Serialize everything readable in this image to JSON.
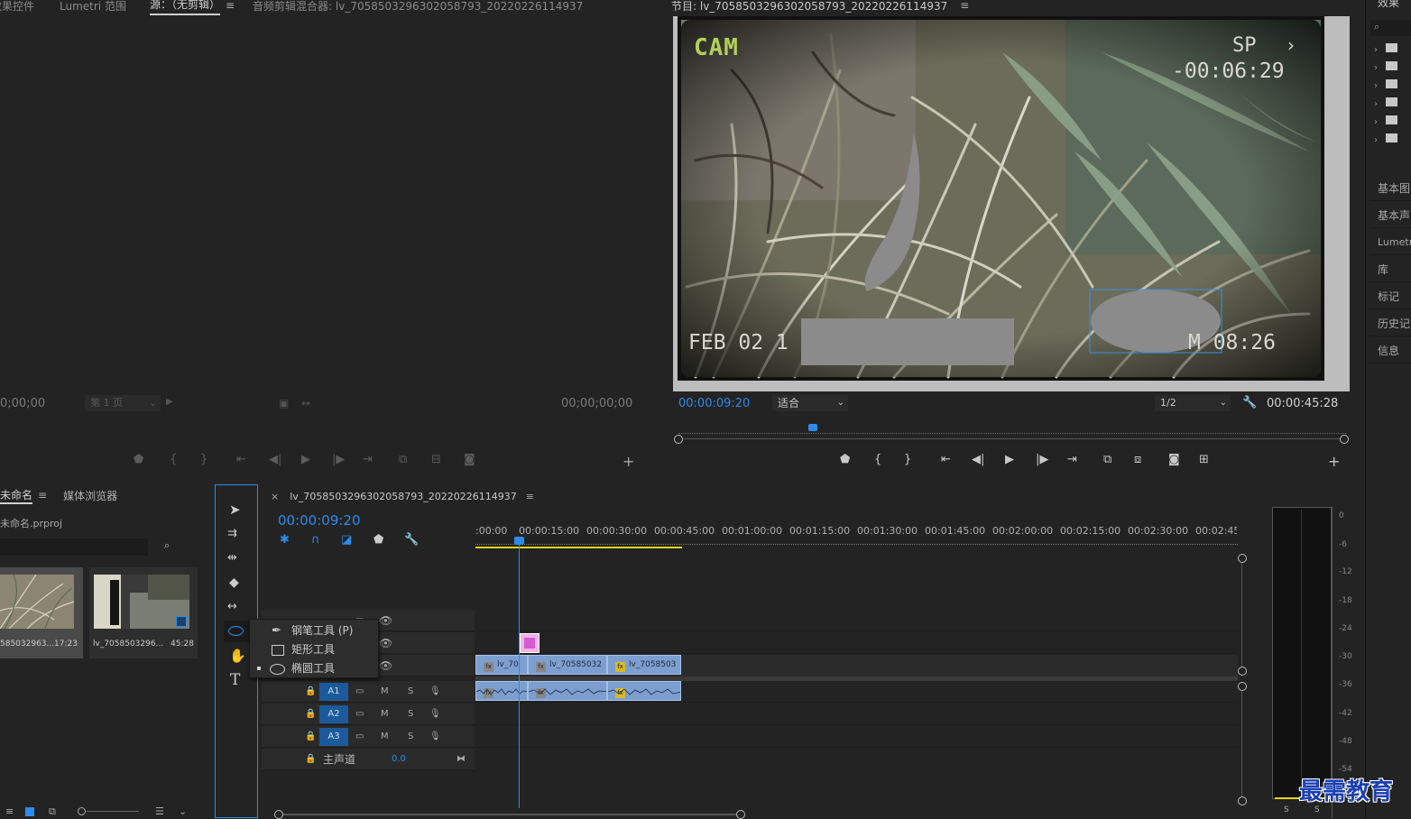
{
  "source_panel": {
    "tabs": [
      "效果控件",
      "Lumetri 范围",
      "源：（无剪辑）",
      "音频剪辑混合器: lv_7058503296302058793_20220226114937"
    ],
    "timecode_left": "0;00;00",
    "page_select": "第 1 页",
    "timecode_right": "00;00;00;00"
  },
  "program_panel": {
    "title": "节目: lv_7058503296302058793_20220226114937",
    "timecode": "00:00:09:20",
    "fit": "适合",
    "resolution": "1/2",
    "duration": "00:00:45:28",
    "overlay": {
      "cam": "CAM",
      "sp": "SP",
      "counter": "-00:06:29",
      "date": "FEB 02 1",
      "time": "M 08:26"
    }
  },
  "right_panel": {
    "title": "效果",
    "items": [
      "基本图",
      "基本声",
      "Lumetri",
      "库",
      "标记",
      "历史记",
      "信息"
    ]
  },
  "project_panel": {
    "tabs": [
      "未命名",
      "媒体浏览器"
    ],
    "project_file": "未命名.prproj",
    "clips": [
      {
        "name": "585032963...",
        "duration": "17:23"
      },
      {
        "name": "lv_7058503296...",
        "duration": "45:28"
      }
    ]
  },
  "timeline": {
    "sequence_tab": "lv_7058503296302058793_20220226114937",
    "timecode": "00:00:09:20",
    "ruler": [
      ":00:00",
      "00:00:15:00",
      "00:00:30:00",
      "00:00:45:00",
      "00:01:00:00",
      "00:01:15:00",
      "00:01:30:00",
      "00:01:45:00",
      "00:02:00:00",
      "00:02:15:00",
      "00:02:30:00",
      "00:02:45:"
    ],
    "video_clips": [
      "lv_70",
      "lv_70585032",
      "lv_7058503"
    ],
    "audio_tracks": [
      {
        "label": "A1",
        "m": "M",
        "s": "S"
      },
      {
        "label": "A2",
        "m": "M",
        "s": "S"
      },
      {
        "label": "A3",
        "m": "M",
        "s": "S"
      }
    ],
    "master_label": "主声道",
    "master_value": "0.0"
  },
  "tool_flyout": {
    "items": [
      "钢笔工具 (P)",
      "矩形工具",
      "椭圆工具"
    ]
  },
  "audio_meter": {
    "scale": [
      "0",
      "-6",
      "-12",
      "-18",
      "-24",
      "-30",
      "-36",
      "-42",
      "-48",
      "-54"
    ],
    "solo": [
      "S",
      "S"
    ]
  },
  "watermark": "最需教育"
}
